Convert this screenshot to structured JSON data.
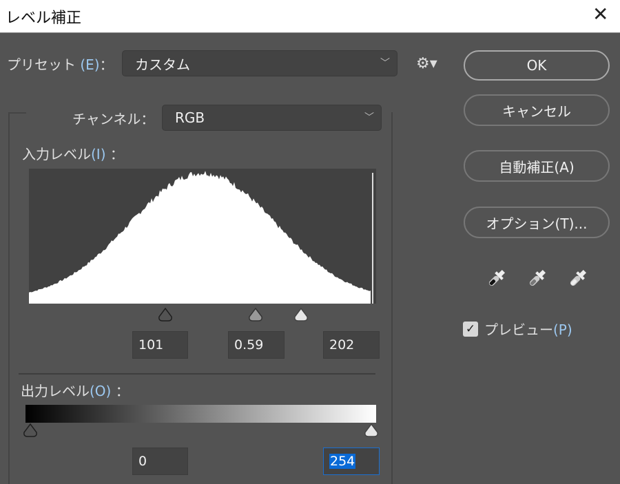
{
  "window": {
    "title": "レベル補正",
    "close": "✕"
  },
  "preset": {
    "label": "プリセット",
    "key": "(E)",
    "colon": "：",
    "value": "カスタム"
  },
  "channel": {
    "label": "チャンネル：",
    "value": "RGB"
  },
  "input_levels": {
    "label": "入力レベル",
    "key": "(I)",
    "colon": "：",
    "black": "101",
    "gamma": "0.59",
    "white": "202"
  },
  "output_levels": {
    "label": "出力レベル",
    "key": "(O)",
    "colon": "：",
    "black": "0",
    "white": "254"
  },
  "buttons": {
    "ok": "OK",
    "cancel": "キャンセル",
    "auto": "自動補正(A)",
    "options": "オプション(T)..."
  },
  "preview": {
    "label": "プレビュー",
    "key": "(P)",
    "checked": true
  },
  "colors": {
    "panel": "#535353",
    "accent": "#0a6ad6"
  }
}
